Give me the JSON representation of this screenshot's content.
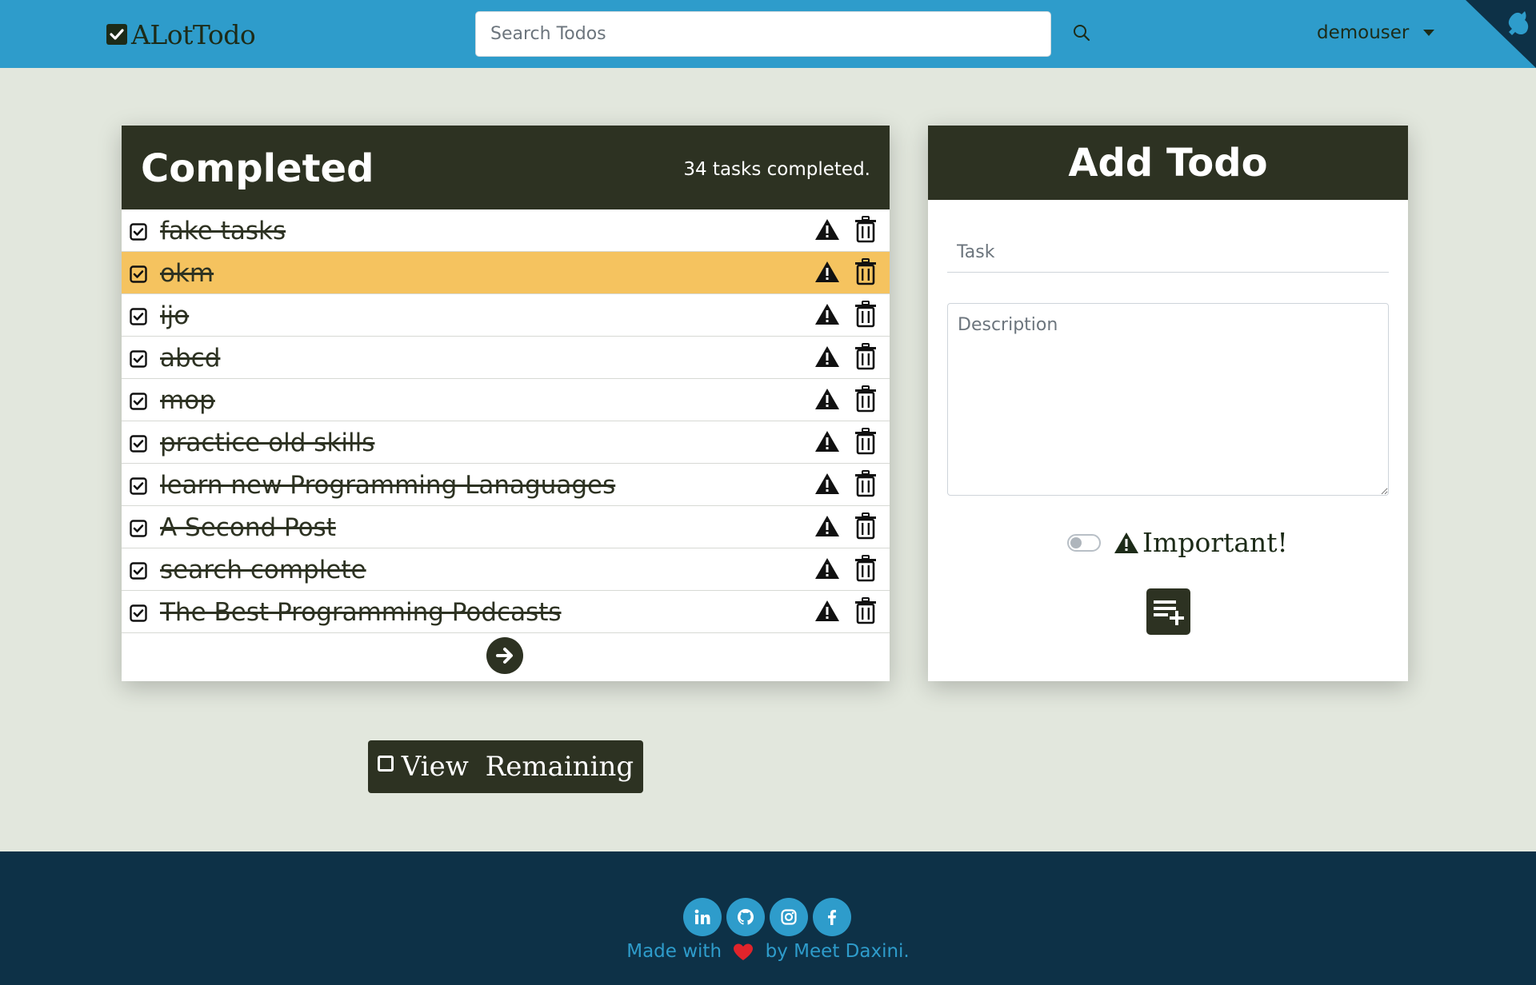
{
  "navbar": {
    "brand": "ALotTodo",
    "search_placeholder": "Search Todos",
    "username": "demouser"
  },
  "completed": {
    "title": "Completed",
    "count_text": "34 tasks completed.",
    "todos": [
      {
        "text": "fake tasks",
        "highlighted": false
      },
      {
        "text": "okm",
        "highlighted": true
      },
      {
        "text": "ijo",
        "highlighted": false
      },
      {
        "text": "abcd",
        "highlighted": false
      },
      {
        "text": "mop",
        "highlighted": false
      },
      {
        "text": "practice old skills",
        "highlighted": false
      },
      {
        "text": "learn new Programming Lanaguages",
        "highlighted": false
      },
      {
        "text": "A Second Post",
        "highlighted": false
      },
      {
        "text": "search complete",
        "highlighted": false
      },
      {
        "text": "The Best Programming Podcasts",
        "highlighted": false
      }
    ]
  },
  "add_todo": {
    "title": "Add Todo",
    "task_placeholder": "Task",
    "description_placeholder": "Description",
    "important_label": "Important!"
  },
  "view_remaining_label": "View  Remaining",
  "footer": {
    "made_prefix": "Made with",
    "made_suffix": "by Meet Daxini.",
    "social_icons": [
      "linkedin-icon",
      "github-icon",
      "instagram-icon",
      "facebook-icon"
    ]
  },
  "colors": {
    "navbar": "#2e9ccb",
    "dark": "#2d3222",
    "highlight": "#f5c35f",
    "background": "#e2e7dd",
    "footer": "#0d3147"
  }
}
